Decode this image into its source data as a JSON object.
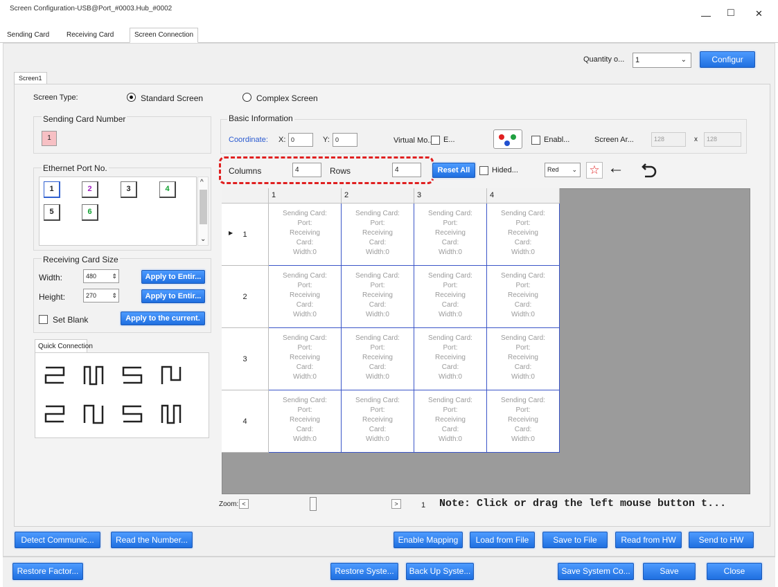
{
  "window": {
    "title": "Screen Configuration-USB@Port_#0003.Hub_#0002",
    "minimize": "—",
    "maximize": "□",
    "close": "✕"
  },
  "tabs": [
    "Sending Card",
    "Receiving Card",
    "Screen Connection"
  ],
  "active_tab": "Screen Connection",
  "quantity": {
    "label": "Quantity o...",
    "value": "1",
    "configure_label": "Configur"
  },
  "screen_tab": "Screen1",
  "screen_type": {
    "label": "Screen Type:",
    "options": [
      "Standard Screen",
      "Complex Screen"
    ],
    "selected": "Standard Screen"
  },
  "sending_card": {
    "title": "Sending Card Number",
    "value": "1"
  },
  "ethernet": {
    "title": "Ethernet Port No.",
    "ports": [
      "1",
      "2",
      "3",
      "4",
      "5",
      "6"
    ]
  },
  "receiving_size": {
    "title": "Receiving Card Size",
    "width_label": "Width:",
    "width_value": "480",
    "height_label": "Height:",
    "height_value": "270",
    "apply_width": "Apply to Entir...",
    "apply_height": "Apply to Entir...",
    "set_blank": "Set Blank",
    "apply_current": "Apply to the current."
  },
  "quick_connection": {
    "title": "Quick Connection"
  },
  "basic": {
    "title": "Basic Information",
    "coordinate_label": "Coordinate:",
    "x_label": "X:",
    "x_value": "0",
    "y_label": "Y:",
    "y_value": "0",
    "virtual_label": "Virtual Mo...",
    "e_label": "E...",
    "enable_label": "Enabl...",
    "screen_area_label": "Screen Ar...",
    "screen_w": "128",
    "x_sep": "x",
    "screen_h": "128"
  },
  "grid_controls": {
    "columns_label": "Columns",
    "columns_value": "4",
    "rows_label": "Rows",
    "rows_value": "4",
    "reset_label": "Reset All",
    "hided_label": "Hided...",
    "color_value": "Red"
  },
  "grid": {
    "col_headers": [
      "1",
      "2",
      "3",
      "4"
    ],
    "row_headers": [
      "1",
      "2",
      "3",
      "4"
    ],
    "cell_lines": [
      "Sending Card:",
      "Port:",
      "Receiving",
      "Card:",
      "Width:0"
    ]
  },
  "zoom": {
    "label": "Zoom:",
    "value": "1"
  },
  "note": "Note: Click or drag the left mouse button t...",
  "bottom_row1": [
    "Detect Communic...",
    "Read the Number...",
    "Enable Mapping",
    "Load from File",
    "Save to File",
    "Read from HW",
    "Send to HW"
  ],
  "bottom_row2": [
    "Restore Factor...",
    "Restore Syste...",
    "Back Up Syste...",
    "Save System Co...",
    "Save",
    "Close"
  ],
  "colors": {
    "accent": "#1f6fe0",
    "highlight": "#e02020",
    "grid_bg": "#9b9b9b",
    "cell_border": "#3a55c8"
  }
}
